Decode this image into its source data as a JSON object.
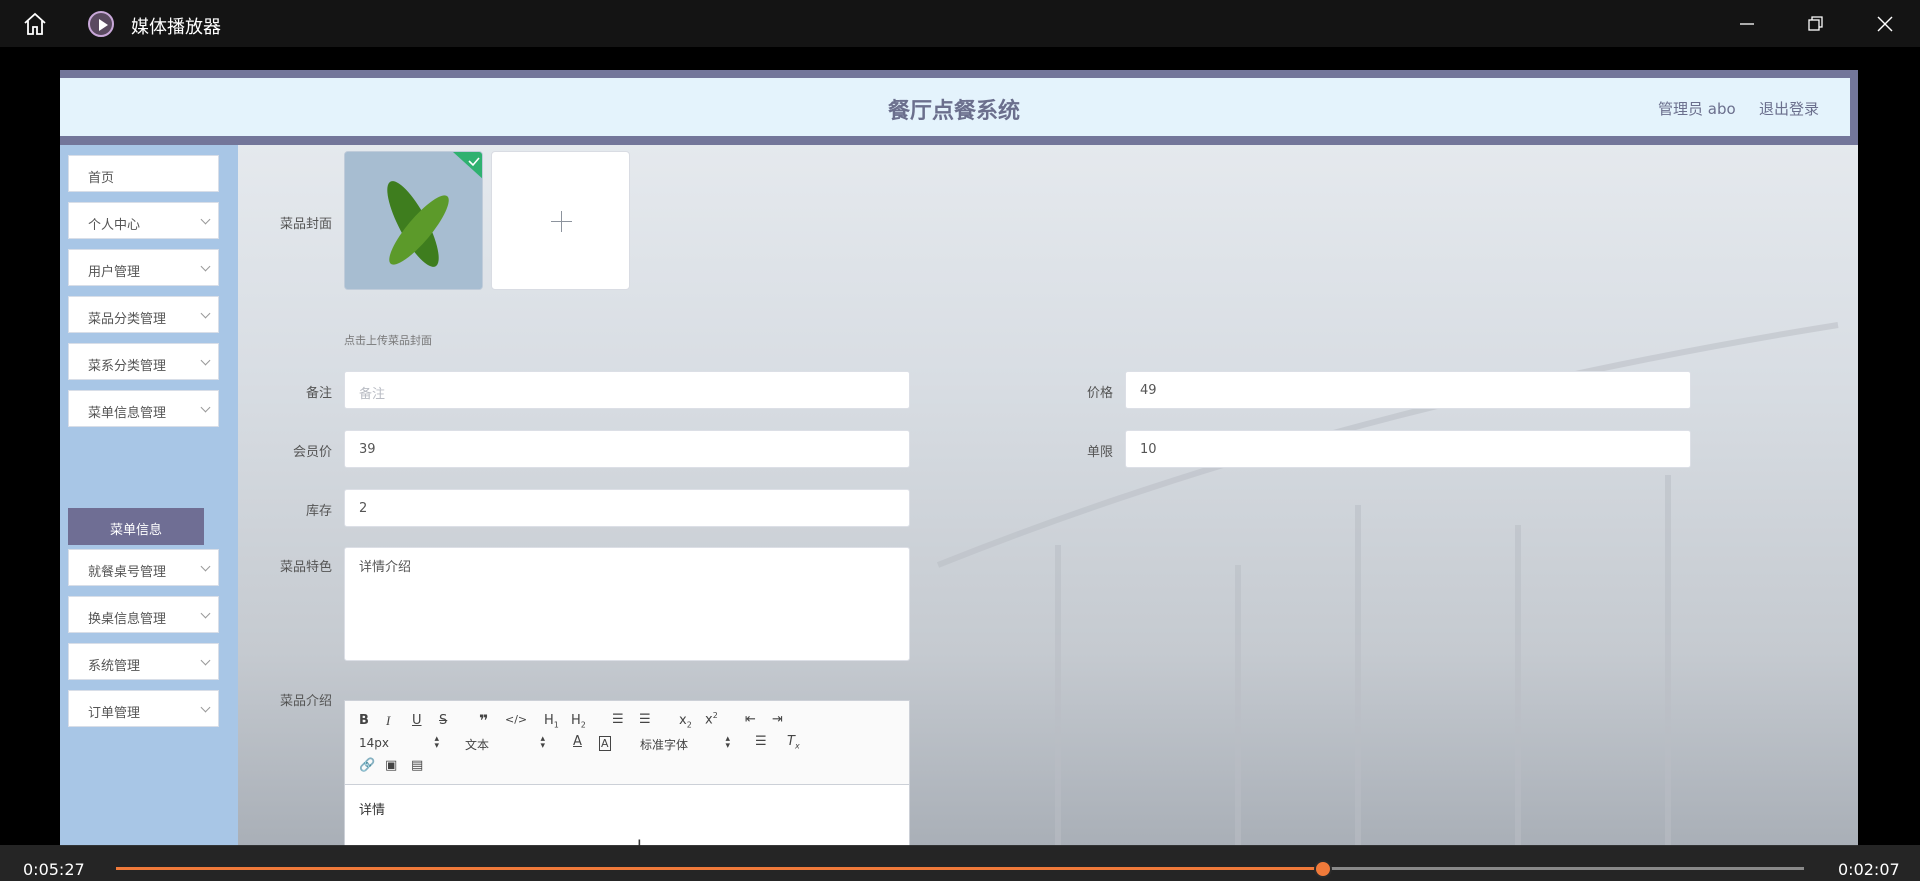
{
  "player": {
    "title": "媒体播放器",
    "current_time": "0:05:27",
    "remaining_time": "0:02:07",
    "progress": 0.715
  },
  "header": {
    "title": "餐厅点餐系统",
    "user": "管理员 abo",
    "logout": "退出登录"
  },
  "sidebar": {
    "items": [
      {
        "label": "首页"
      },
      {
        "label": "个人中心"
      },
      {
        "label": "用户管理"
      },
      {
        "label": "菜品分类管理"
      },
      {
        "label": "菜系分类管理"
      },
      {
        "label": "菜单信息管理"
      },
      {
        "label": "就餐桌号管理"
      },
      {
        "label": "换桌信息管理"
      },
      {
        "label": "系统管理"
      },
      {
        "label": "订单管理"
      }
    ],
    "active_sub": "菜单信息"
  },
  "form": {
    "cover_label": "菜品封面",
    "cover_tip": "点击上传菜品封面",
    "remark_label": "备注",
    "remark_placeholder": "备注",
    "price_label": "价格",
    "price_value": "49",
    "member_price_label": "会员价",
    "member_price_value": "39",
    "limit_label": "单限",
    "limit_value": "10",
    "stock_label": "库存",
    "stock_value": "2",
    "feature_label": "菜品特色",
    "feature_value": "详情介绍",
    "intro_label": "菜品介绍"
  },
  "editor": {
    "font_size": "14px",
    "format": "文本",
    "font_family": "标准字体",
    "content": "详情"
  },
  "colors": {
    "accent": "#f07a3a",
    "menu_active": "#6f6e94",
    "header_bg": "#e4f3fc",
    "sidebar_bg": "#a8c6e6"
  }
}
